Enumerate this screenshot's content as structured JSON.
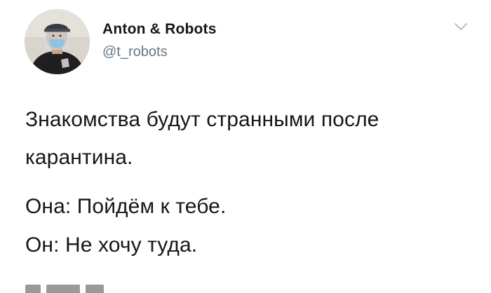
{
  "tweet": {
    "author": {
      "name": "Anton & Robots",
      "handle": "@t_robots",
      "avatar_icon": "user-avatar-with-mask"
    },
    "menu_icon": "chevron-down-icon",
    "lines": [
      "Знакомства будут странными после",
      "карантина.",
      "Она: Пойдём к тебе.",
      "Он: Не хочу туда."
    ]
  },
  "colors": {
    "text": "#14171a",
    "secondary": "#657786",
    "chevron": "#aab8c2",
    "background": "#ffffff"
  }
}
